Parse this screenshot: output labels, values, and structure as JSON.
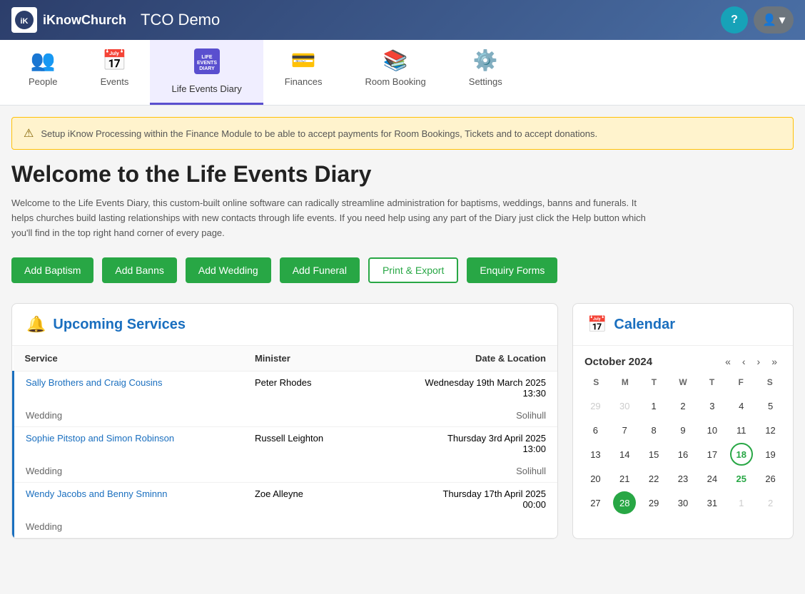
{
  "header": {
    "logo_text": "iKnow",
    "logo_bold": "Church",
    "logo_icon": "iK",
    "title": "TCO Demo",
    "help_label": "?",
    "user_icon": "👤"
  },
  "nav": {
    "tabs": [
      {
        "id": "people",
        "label": "People",
        "icon": "👥",
        "active": false
      },
      {
        "id": "events",
        "label": "Events",
        "icon": "📅",
        "active": false
      },
      {
        "id": "life-events-diary",
        "label": "Life Events Diary",
        "icon": "📖",
        "active": true
      },
      {
        "id": "finances",
        "label": "Finances",
        "icon": "💳",
        "active": false
      },
      {
        "id": "room-booking",
        "label": "Room Booking",
        "icon": "📚",
        "active": false
      },
      {
        "id": "settings",
        "label": "Settings",
        "icon": "⚙️",
        "active": false
      }
    ]
  },
  "alert": {
    "message": "Setup iKnow Processing within the Finance Module to be able to accept payments for Room Bookings, Tickets and to accept donations."
  },
  "page": {
    "title": "Welcome to the Life Events Diary",
    "description": "Welcome to the Life Events Diary, this custom-built online software can radically streamline administration for baptisms, weddings, banns and funerals. It helps churches build lasting relationships with new contacts through life events. If you need help using any part of the Diary just click the Help button which you'll find in the top right hand corner of every page."
  },
  "action_buttons": [
    {
      "id": "add-baptism",
      "label": "Add Baptism",
      "style": "green"
    },
    {
      "id": "add-banns",
      "label": "Add Banns",
      "style": "green"
    },
    {
      "id": "add-wedding",
      "label": "Add Wedding",
      "style": "green"
    },
    {
      "id": "add-funeral",
      "label": "Add Funeral",
      "style": "green"
    },
    {
      "id": "print-export",
      "label": "Print & Export",
      "style": "outline-green"
    },
    {
      "id": "enquiry-forms",
      "label": "Enquiry Forms",
      "style": "green"
    }
  ],
  "upcoming_services": {
    "title": "Upcoming Services",
    "columns": [
      "Service",
      "Minister",
      "Date & Location"
    ],
    "rows": [
      {
        "name": "Sally Brothers and Craig Cousins",
        "type": "Wedding",
        "minister": "Peter Rhodes",
        "date": "Wednesday 19th March 2025",
        "time": "13:30",
        "location": "Solihull"
      },
      {
        "name": "Sophie Pitstop and Simon Robinson",
        "type": "Wedding",
        "minister": "Russell Leighton",
        "date": "Thursday 3rd April 2025",
        "time": "13:00",
        "location": "Solihull"
      },
      {
        "name": "Wendy Jacobs and Benny Sminnn",
        "type": "Wedding",
        "minister": "Zoe Alleyne",
        "date": "Thursday 17th April 2025",
        "time": "00:00",
        "location": ""
      }
    ]
  },
  "calendar": {
    "title": "Calendar",
    "month": "October 2024",
    "day_headers": [
      "S",
      "M",
      "T",
      "W",
      "T",
      "F",
      "S"
    ],
    "weeks": [
      [
        {
          "day": 29,
          "other": true
        },
        {
          "day": 30,
          "other": true
        },
        {
          "day": 1
        },
        {
          "day": 2
        },
        {
          "day": 3
        },
        {
          "day": 4
        },
        {
          "day": 5
        }
      ],
      [
        {
          "day": 6
        },
        {
          "day": 7
        },
        {
          "day": 8
        },
        {
          "day": 9
        },
        {
          "day": 10
        },
        {
          "day": 11
        },
        {
          "day": 12
        }
      ],
      [
        {
          "day": 13
        },
        {
          "day": 14
        },
        {
          "day": 15
        },
        {
          "day": 16
        },
        {
          "day": 17
        },
        {
          "day": 18,
          "highlight": true
        },
        {
          "day": 19
        }
      ],
      [
        {
          "day": 20
        },
        {
          "day": 21
        },
        {
          "day": 22
        },
        {
          "day": 23
        },
        {
          "day": 24
        },
        {
          "day": 25,
          "highlight2": true
        },
        {
          "day": 26
        }
      ],
      [
        {
          "day": 27
        },
        {
          "day": 28,
          "today": true
        },
        {
          "day": 29
        },
        {
          "day": 30
        },
        {
          "day": 31
        },
        {
          "day": 1,
          "other": true
        },
        {
          "day": 2,
          "other": true
        }
      ]
    ]
  }
}
